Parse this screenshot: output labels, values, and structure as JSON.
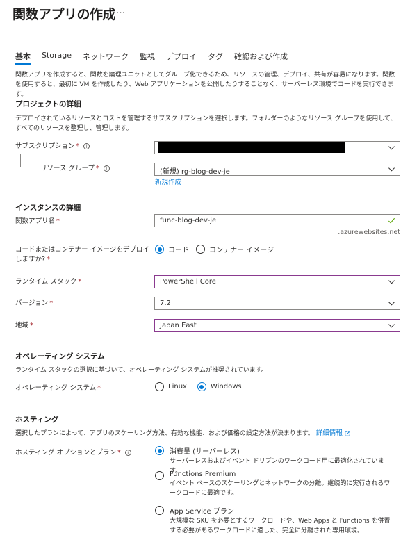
{
  "page": {
    "title": "関数アプリの作成",
    "more": "…"
  },
  "tabs": [
    "基本",
    "Storage",
    "ネットワーク",
    "監視",
    "デプロイ",
    "タグ",
    "確認および作成"
  ],
  "intro": "関数アプリを作成すると、関数を論理ユニットとしてグループ化できるため、リソースの管理、デプロイ、共有が容易になります。関数を使用すると、最初に VM を作成したり、Web アプリケーションを公開したりすることなく、サーバーレス環境でコードを実行できます。",
  "project": {
    "heading": "プロジェクトの詳細",
    "description": "デプロイされているリソースとコストを管理するサブスクリプションを選択します。フォルダーのようなリソース グループを使用して、すべてのリソースを整理し、管理します。",
    "subscription_label": "サブスクリプション",
    "resource_group_label": "リソース グループ",
    "resource_group_value": "(新規) rg-blog-dev-je",
    "create_new_link": "新規作成"
  },
  "instance": {
    "heading": "インスタンスの詳細",
    "app_name_label": "関数アプリ名",
    "app_name_value": "func-blog-dev-je",
    "domain_suffix": ".azurewebsites.net",
    "deploy_label": "コードまたはコンテナー イメージをデプロイしますか?",
    "deploy_options": [
      "コード",
      "コンテナー イメージ"
    ],
    "runtime_label": "ランタイム スタック",
    "runtime_value": "PowerShell Core",
    "version_label": "バージョン",
    "version_value": "7.2",
    "region_label": "地域",
    "region_value": "Japan East"
  },
  "os": {
    "heading": "オペレーティング システム",
    "description": "ランタイム スタックの選択に基づいて、オペレーティング システムが推奨されています。",
    "label": "オペレーティング システム",
    "options": [
      "Linux",
      "Windows"
    ]
  },
  "hosting": {
    "heading": "ホスティング",
    "description": "選択したプランによって、アプリのスケーリング方法、有効な機能、および価格の設定方法が決まります。",
    "details_link": "詳細情報",
    "label": "ホスティング オプションとプラン",
    "plans": [
      {
        "name": "消費量 (サーバーレス)",
        "desc": "サーバーレスおよびイベント ドリブンのワークロード用に最適化されています。"
      },
      {
        "name": "Functions Premium",
        "desc": "イベント ベースのスケーリングとネットワークの分離。継続的に実行されるワークロードに最適です。"
      },
      {
        "name": "App Service プラン",
        "desc": "大規模な SKU を必要とするワークロードや、Web Apps と Functions を併置する必要があるワークロードに適した、完全に分離された専用環境。"
      }
    ]
  },
  "colors": {
    "accent": "#0078d4",
    "required": "#a4262c",
    "focus_border": "#8a3a8f"
  },
  "icons": [
    "more-icon",
    "info-icon",
    "chevron-down-icon",
    "checkmark-icon",
    "external-link-icon"
  ]
}
